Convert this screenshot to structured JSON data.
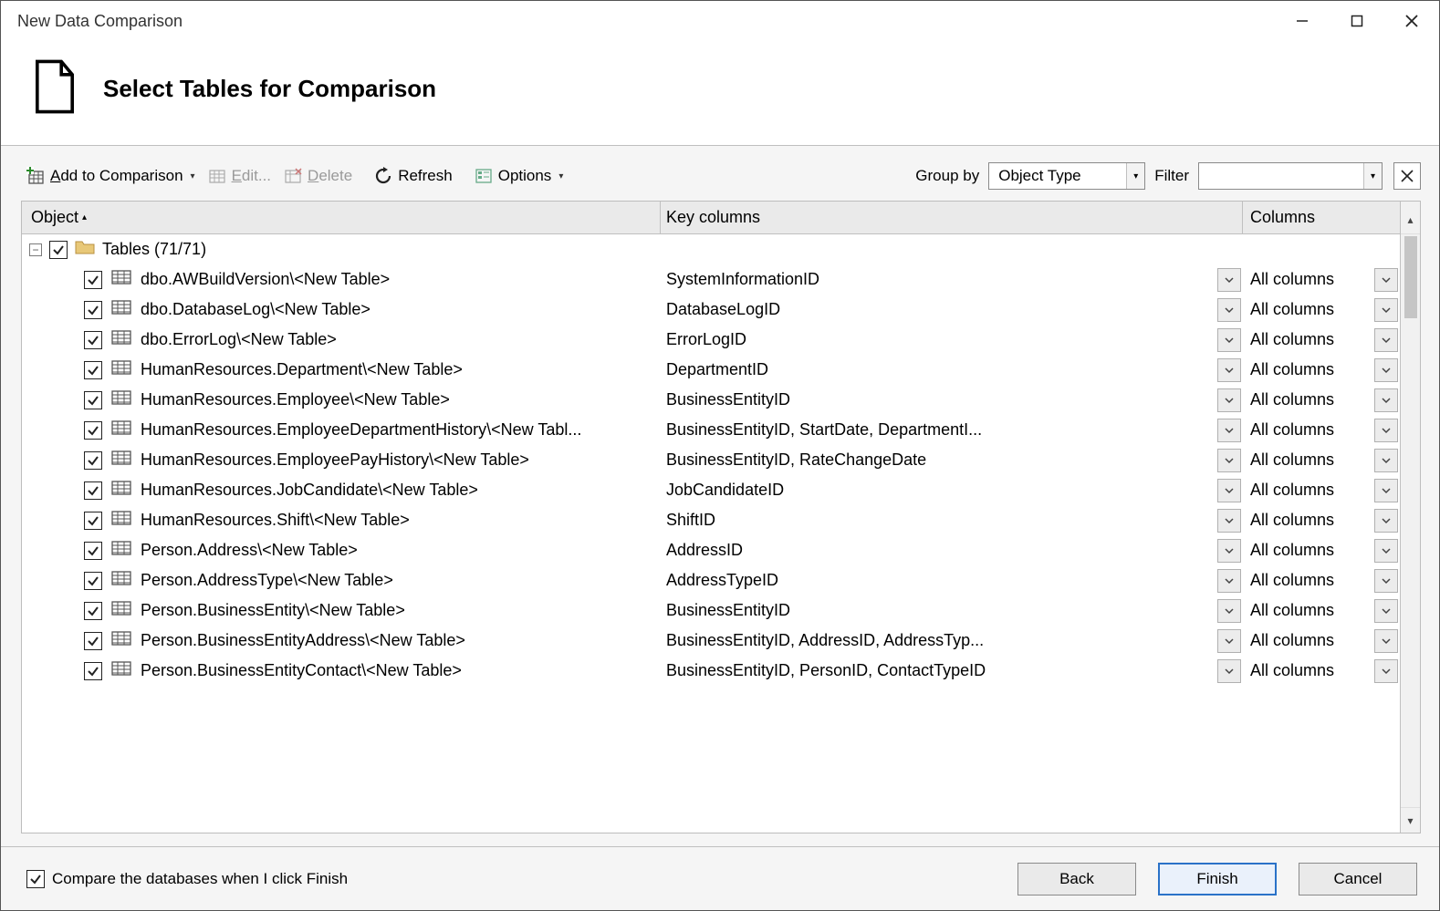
{
  "window": {
    "title": "New Data Comparison"
  },
  "header": {
    "title": "Select Tables for Comparison"
  },
  "toolbar": {
    "add": "Add to Comparison",
    "edit": "Edit...",
    "delete": "Delete",
    "refresh": "Refresh",
    "options": "Options",
    "groupby_label": "Group by",
    "groupby_value": "Object Type",
    "filter_label": "Filter"
  },
  "grid": {
    "headers": {
      "object": "Object",
      "key": "Key columns",
      "columns": "Columns"
    },
    "group_label": "Tables (71/71)",
    "all_columns": "All columns",
    "rows": [
      {
        "object": "dbo.AWBuildVersion\\<New Table>",
        "key": "SystemInformationID"
      },
      {
        "object": "dbo.DatabaseLog\\<New Table>",
        "key": "DatabaseLogID"
      },
      {
        "object": "dbo.ErrorLog\\<New Table>",
        "key": "ErrorLogID"
      },
      {
        "object": "HumanResources.Department\\<New Table>",
        "key": "DepartmentID"
      },
      {
        "object": "HumanResources.Employee\\<New Table>",
        "key": "BusinessEntityID"
      },
      {
        "object": "HumanResources.EmployeeDepartmentHistory\\<New Tabl...",
        "key": "BusinessEntityID, StartDate, DepartmentI..."
      },
      {
        "object": "HumanResources.EmployeePayHistory\\<New Table>",
        "key": "BusinessEntityID, RateChangeDate"
      },
      {
        "object": "HumanResources.JobCandidate\\<New Table>",
        "key": "JobCandidateID"
      },
      {
        "object": "HumanResources.Shift\\<New Table>",
        "key": "ShiftID"
      },
      {
        "object": "Person.Address\\<New Table>",
        "key": "AddressID"
      },
      {
        "object": "Person.AddressType\\<New Table>",
        "key": "AddressTypeID"
      },
      {
        "object": "Person.BusinessEntity\\<New Table>",
        "key": "BusinessEntityID"
      },
      {
        "object": "Person.BusinessEntityAddress\\<New Table>",
        "key": "BusinessEntityID, AddressID, AddressTyp..."
      },
      {
        "object": "Person.BusinessEntityContact\\<New Table>",
        "key": "BusinessEntityID, PersonID, ContactTypeID"
      }
    ]
  },
  "footer": {
    "compare_checkbox": "Compare the databases when I click Finish",
    "back": "Back",
    "finish": "Finish",
    "cancel": "Cancel"
  }
}
